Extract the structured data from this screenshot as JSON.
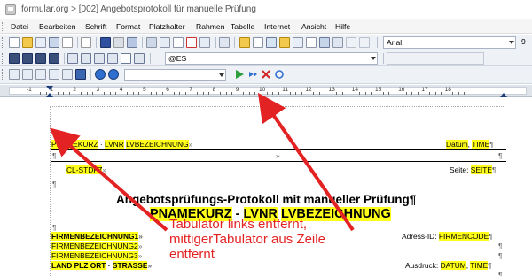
{
  "window": {
    "title": "formular.org > [002] Angebotsprotokoll für manuelle Prüfung"
  },
  "menu": [
    "Datei",
    "Bearbeiten",
    "Schrift",
    "Format",
    "Platzhalter",
    "Rahmen",
    "Tabelle",
    "Internet",
    "Ansicht",
    "Hilfe"
  ],
  "toolbar": {
    "font_name": "Arial",
    "font_size": "9",
    "style_value": "@ES",
    "icons": [
      "new-doc-icon",
      "open-icon",
      "save-icon",
      "print-icon",
      "preview-icon",
      "cut-icon",
      "copy-icon",
      "paste-icon",
      "undo-icon",
      "redo-icon",
      "spellcheck-icon",
      "find-icon",
      "table-icon",
      "image-icon",
      "delete-icon",
      "bold-icon",
      "italic-icon",
      "underline-icon",
      "align-left-icon",
      "align-center-icon",
      "align-right-icon",
      "justify-icon",
      "paragraph-icon",
      "bullets-icon",
      "numbering-icon",
      "indent-icon",
      "outdent-icon",
      "border-icon",
      "font-grow-icon",
      "superscript-icon",
      "subscript-icon",
      "link-icon",
      "unlink-icon",
      "play-icon",
      "step-icon",
      "stop-icon",
      "refresh-icon"
    ]
  },
  "ruler": {
    "numbers": [
      "-1",
      "1",
      "2",
      "3",
      "4",
      "5",
      "6",
      "7",
      "8",
      "9",
      "10",
      "11",
      "12",
      "13",
      "14",
      "15",
      "16",
      "17",
      "18"
    ]
  },
  "doc": {
    "header_left_1": "PNAMEKURZ",
    "header_sep_1": "·",
    "header_left_2": "LVNR",
    "header_left_3": "LVBEZEICHNUNG",
    "header_arrow": "»",
    "header_right_1": "Datum",
    "header_comma": ",",
    "header_right_2": "TIME",
    "pilcrow": "¶",
    "row2_left": "CL-STDFZ",
    "row2_arrow": "»",
    "row2_right_label": "Seite:",
    "row2_right_value": "SEITE",
    "title_line1": "Angebotsprüfungs-Protokoll mit manueller Prüfung¶",
    "title_line2_a": "PNAMEKURZ",
    "title_line2_dash1": " - ",
    "title_line2_b": "LVNR",
    "title_line2_c": "LVBEZEICHNUNG",
    "firm1": "FIRMENBEZEICHNUNG1",
    "firm2": "FIRMENBEZEICHNUNG2",
    "firm3": "FIRMENBEZEICHNUNG3",
    "firm_arrow": "»",
    "land": "LAND PLZ ORT",
    "strasse": "STRASSE",
    "adress_label": "Adress-ID:",
    "adress_value": "FIRMENCODE",
    "ausdruck_label": "Ausdruck:",
    "ausdruck_datum": "DATUM",
    "ausdruck_time": "TIME"
  },
  "annotation": {
    "line1": "Tabulator links entfernt,",
    "line2": "mittigerTabulator aus Zeile",
    "line3": "entfernt",
    "color": "#e32323"
  }
}
